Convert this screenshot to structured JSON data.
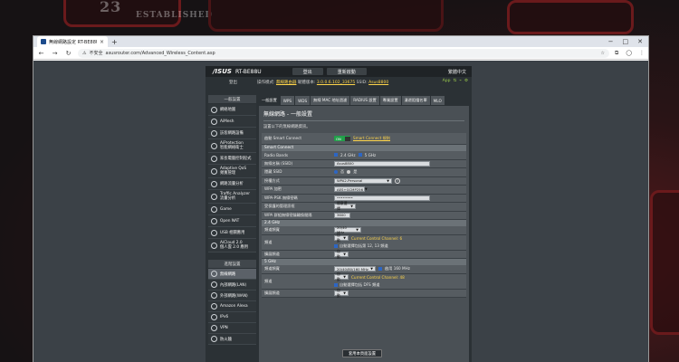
{
  "wallpaper": {
    "texts": [
      "23",
      "ESTABLISHED"
    ]
  },
  "browser": {
    "tab_title": "無線網路設定 RT-BE88U",
    "new_tab": "+",
    "window_controls": [
      "−",
      "□",
      "✕"
    ],
    "address_prefix": "不安全",
    "url": "asusrouter.com/Advanced_Wireless_Content.asp"
  },
  "router": {
    "logo": "/ISUS",
    "model": "RT-BE88U",
    "header_buttons": [
      "登出",
      "重新啟動"
    ],
    "language": "繁體中文",
    "logout_short": "登出",
    "info": {
      "mode_label": "操作模式:",
      "mode_value": "無線路由器",
      "firmware_label": "韌體版本:",
      "firmware_value": "3.0.0.6.102_33675",
      "ssid_label": "SSID:",
      "ssid_value": "Asus8800"
    },
    "status_labels": [
      "App"
    ],
    "menu": {
      "general_head": "一般設置",
      "general_items": [
        "網絡地圖",
        "AiMesh",
        "訪客網路設備",
        "AiProtection\n智能網絡衛士",
        "家長電腦控制程式",
        "Adaptive QoS\n頻寬管理",
        "網路流量分析",
        "Traffic Analyzer\n流量分析",
        "Game",
        "Open NAT",
        "USB 相關應用",
        "AiCloud 2.0\n個人雲 2.0 應用"
      ],
      "advanced_head": "進階設置",
      "advanced_items": [
        "無線網路",
        "內部網路(LAN)",
        "外部網路(WAN)",
        "Amazon Alexa",
        "IPv6",
        "VPN",
        "防火牆"
      ]
    },
    "tabs": [
      "一般設置",
      "WPS",
      "WDS",
      "無線 MAC 地址過濾",
      "RADIUS 設置",
      "專業設置",
      "漫遊阻擋名單",
      "MLO"
    ],
    "panel": {
      "title": "無線網路 - 一般設置",
      "desc": "設置以下的無線網路資訊。",
      "rows": {
        "smart_connect_label": "啟動 Smart Connect",
        "smart_connect_toggle": "ON",
        "smart_connect_link": "Smart Connect 規則",
        "section_smart": "Smart Connect",
        "radio_bands_label": "Radio Bands",
        "band_24": "2.4 GHz",
        "band_5": "5 GHz",
        "ssid_label": "無線名稱 (SSID)",
        "ssid_value": "Asus8800",
        "hide_ssid_label": "隱藏 SSID",
        "hide_no": "否",
        "hide_yes": "是",
        "auth_label": "授權方式",
        "auth_value": "WPA2-Personal",
        "wpa_enc_label": "WPA 加密",
        "wpa_enc_value": "AES+GCMP256",
        "wpa_key_label": "WPA-PSK 無線密碼",
        "wpa_key_value": "••••••••",
        "pmf_label": "受保護的管理訊框",
        "pmf_value": "隨意選擇",
        "rekey_label": "WPA 群組無線密鑰輪換間隔",
        "rekey_value": "3600",
        "section_24": "2.4 GHz",
        "bw24_label": "頻道頻寬",
        "bw24_value": "20/40 MHz",
        "ch24_label": "頻道",
        "ch24_value": "自動",
        "ch24_current": "Current Control Channel: 6",
        "ch24_auto": "自動選擇包括第 12, 13 頻道",
        "ext24_label": "擴展頻道",
        "ext24_value": "自動",
        "section_5": "5 GHz",
        "bw5_label": "頻道頻寬",
        "bw5_value": "20/40/80/160 MHz",
        "bw5_enable": "啟用 160 MHz",
        "ch5_label": "頻道",
        "ch5_value": "自動",
        "ch5_current": "Current Control Channel: 48",
        "ch5_auto": "自動選擇包括 DFS 頻道",
        "ext5_label": "擴展頻道",
        "ext5_value": "自動"
      },
      "apply": "套用本頁面設置"
    }
  }
}
